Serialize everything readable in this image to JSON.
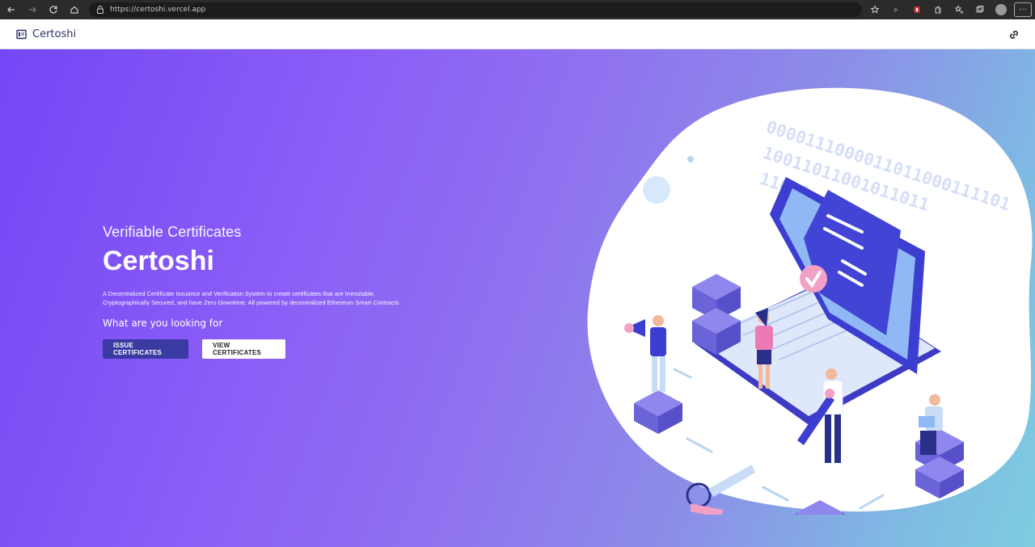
{
  "browser": {
    "url": "https://certoshi.vercel.app",
    "more_label": "···"
  },
  "app": {
    "brand": "Certoshi"
  },
  "hero": {
    "subtitle": "Verifiable Certificates",
    "title": "Certoshi",
    "description": "A Decentralized Certificate Issuance and Verification System to create certificates that are Immutable, Cryptographically Secured, and have Zero Downtime. All powered by decentralized Ethereum Smart Contracts",
    "question": "What are you looking for",
    "issue_label": "ISSUE CERTIFICATES",
    "view_label": "VIEW CERTIFICATES"
  },
  "illustration": {
    "binary_line_1": "0000111000011011000111101",
    "binary_line_2": "10011011001011011",
    "binary_line_3": "11010",
    "icon": "certificate-laptop-illustration"
  },
  "colors": {
    "primary_button": "#3a3aa3",
    "brand_text": "#2b2f6b",
    "gradient_start": "#7446f6",
    "gradient_end": "#7dcde0"
  }
}
